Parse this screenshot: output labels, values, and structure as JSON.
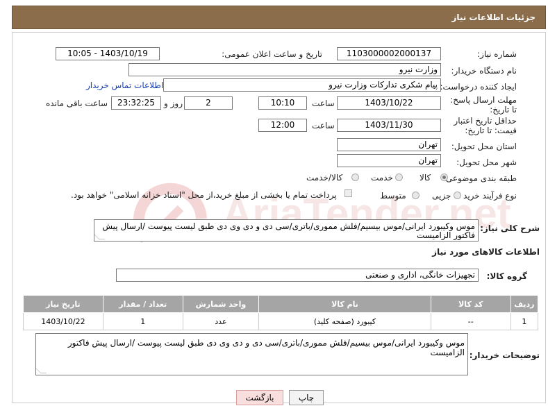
{
  "header": {
    "title": "جزئیات اطلاعات نیاز"
  },
  "form": {
    "need_number_label": "شماره نیاز:",
    "need_number": "1103000002000137",
    "announce_label": "تاریخ و ساعت اعلان عمومی:",
    "announce_value": "1403/10/19 - 10:05",
    "buyer_label": "نام دستگاه خریدار:",
    "buyer_value": "وزارت نیرو",
    "creator_label": "ایجاد کننده درخواست:",
    "creator_value": "پیام شکری تدارکات وزارت نیرو",
    "contact_link": "اطلاعات تماس خریدار",
    "reply_deadline_label": "مهلت ارسال پاسخ: تا تاریخ:",
    "reply_date": "1403/10/22",
    "hour_label": "ساعت",
    "reply_time": "10:10",
    "day_value": "2",
    "day_and_label": "روز و",
    "remaining_time": "23:32:25",
    "remaining_label": "ساعت باقی مانده",
    "price_deadline_label": "حداقل تاریخ اعتبار قیمت: تا تاریخ:",
    "price_date": "1403/11/30",
    "price_hour_label": "ساعت",
    "price_time": "12:00",
    "province_label": "استان محل تحویل:",
    "province_value": "تهران",
    "city_label": "شهر محل تحویل:",
    "city_value": "تهران",
    "category_label": "طبقه بندی موضوعی:",
    "category_options": [
      "کالا",
      "خدمت",
      "کالا/خدمت"
    ],
    "process_label": "نوع فرآیند خرید :",
    "process_options": [
      "جزیی",
      "متوسط"
    ],
    "treasury_note": "پرداخت تمام یا بخشی از مبلغ خرید،از محل \"اسناد خزانه اسلامی\" خواهد بود."
  },
  "description": {
    "label": "شرح کلی نیاز:",
    "text": "موس وکیبورد ایرانی/موس بیسیم/فلش مموری/باتری/سی دی و دی وی دی طبق لیست پیوست /ارسال پیش فاکتور الزامیست"
  },
  "goods": {
    "section_title": "اطلاعات کالاهای مورد نیاز",
    "group_label": "گروه کالا:",
    "group_value": "تجهیزات خانگی، اداری و صنعتی",
    "columns": [
      "ردیف",
      "کد کالا",
      "نام کالا",
      "واحد شمارش",
      "تعداد / مقدار",
      "تاریخ نیاز"
    ],
    "rows": [
      {
        "row": "1",
        "code": "--",
        "name": "کیبورد (صفحه کلید)",
        "unit": "عدد",
        "qty": "1",
        "date": "1403/10/22"
      }
    ]
  },
  "buyer_notes": {
    "label": "توضیحات خریدار:",
    "text": "موس وکیبورد ایرانی/موس بیسیم/فلش مموری/باتری/سی دی و دی وی دی طبق لیست پیوست /ارسال پیش فاکتور الزامیست"
  },
  "buttons": {
    "print": "چاپ",
    "back": "بازگشت"
  },
  "watermark": "AriaTender.net",
  "colors": {
    "title_bg": "#8b6d4b",
    "table_header": "#a5a5a5",
    "back_button_bg": "#f9dede",
    "link": "#1a3fb0"
  }
}
